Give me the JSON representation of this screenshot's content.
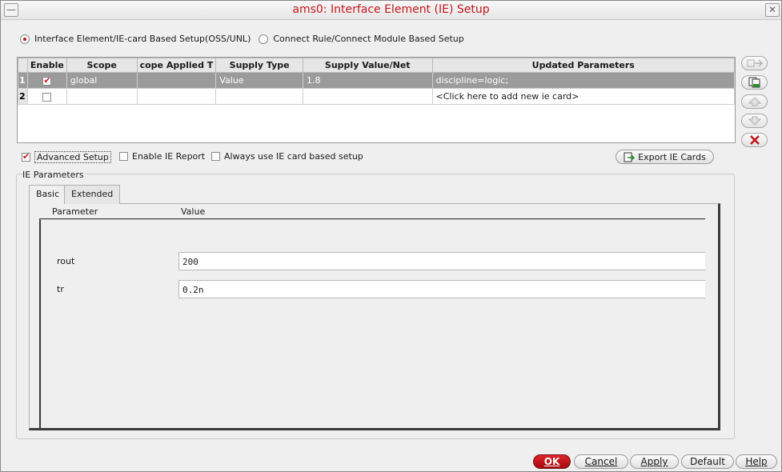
{
  "window": {
    "title": "ams0: Interface Element (IE) Setup",
    "minimize_glyph": "—",
    "close_glyph": "✕"
  },
  "setup_mode": {
    "options": [
      {
        "label": "Interface Element/IE-card Based Setup(OSS/UNL)",
        "selected": true
      },
      {
        "label": "Connect Rule/Connect Module Based Setup",
        "selected": false
      }
    ]
  },
  "ie_table": {
    "columns": [
      "Enable",
      "Scope",
      "cope Applied T",
      "Supply Type",
      "Supply Value/Net",
      "Updated Parameters"
    ],
    "rows": [
      {
        "num": "1",
        "enabled": true,
        "scope": "global",
        "scope_applied": "",
        "supply_type": "Value",
        "supply_value": "1.8",
        "updated_params": "discipline=logic;",
        "selected": true
      },
      {
        "num": "2",
        "enabled": false,
        "scope": "",
        "scope_applied": "",
        "supply_type": "",
        "supply_value": "",
        "updated_params": "<Click here to add new ie card>",
        "selected": false
      }
    ]
  },
  "side_buttons": [
    {
      "name": "move-icon"
    },
    {
      "name": "copy-card-icon"
    },
    {
      "name": "up-arrow-icon"
    },
    {
      "name": "down-arrow-icon"
    },
    {
      "name": "delete-icon"
    }
  ],
  "options": {
    "advanced_setup": {
      "label": "Advanced Setup",
      "checked": true
    },
    "enable_ie_report": {
      "label": "Enable IE Report",
      "checked": false
    },
    "always_use_ie_card": {
      "label": "Always use IE card based setup",
      "checked": false
    },
    "export_button": "Export IE Cards"
  },
  "ie_parameters": {
    "group_label": "IE Parameters",
    "tabs": [
      {
        "label": "Basic",
        "active": true
      },
      {
        "label": "Extended",
        "active": false
      }
    ],
    "header_parameter": "Parameter",
    "header_value": "Value",
    "params": [
      {
        "name": "rout",
        "value": "200"
      },
      {
        "name": "tr",
        "value": "0.2n"
      }
    ]
  },
  "buttons": {
    "ok": "OK",
    "cancel": "Cancel",
    "apply": "Apply",
    "default": "Default",
    "help": "Help"
  },
  "colors": {
    "title": "#c4161c",
    "accent": "#c4161c",
    "selected_row": "#9b9b9b"
  }
}
